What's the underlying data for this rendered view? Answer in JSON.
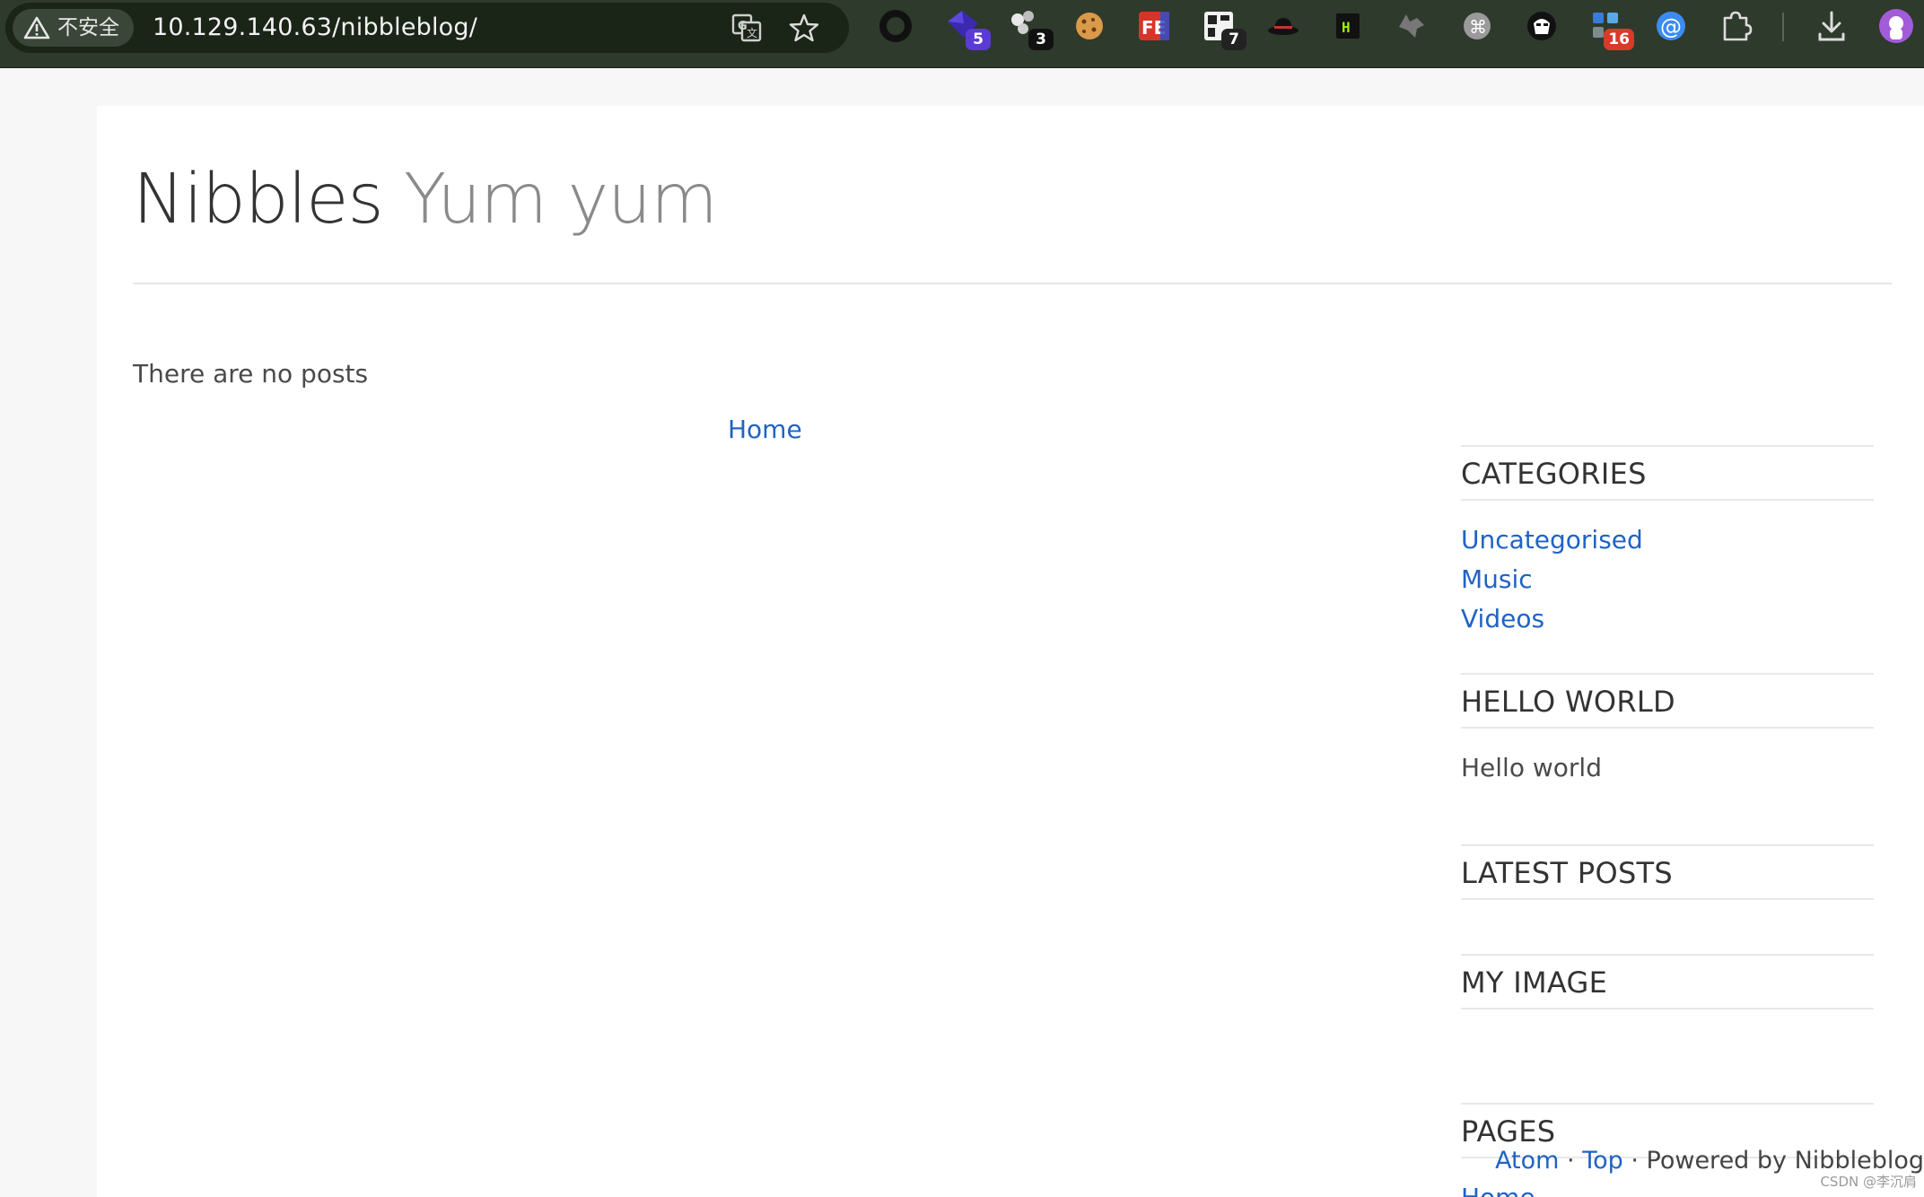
{
  "browser": {
    "security_label": "不安全",
    "url": "10.129.140.63/nibbleblog/",
    "extensions": [
      {
        "icon": "ring-icon",
        "badge": ""
      },
      {
        "icon": "diamond-icon",
        "badge": "5",
        "badge_color": "#5b3bd6"
      },
      {
        "icon": "dots-icon",
        "badge": "3",
        "badge_color": "#111111"
      },
      {
        "icon": "cookie-icon",
        "badge": ""
      },
      {
        "icon": "fe-icon",
        "badge": ""
      },
      {
        "icon": "qr-icon",
        "badge": "7",
        "badge_color": "#222222"
      },
      {
        "icon": "hat-icon",
        "badge": ""
      },
      {
        "icon": "hackthebox-icon",
        "badge": ""
      },
      {
        "icon": "wolf-icon",
        "badge": ""
      },
      {
        "icon": "command-icon",
        "badge": ""
      },
      {
        "icon": "hacker-mask-icon",
        "badge": ""
      },
      {
        "icon": "apps-icon",
        "badge": "16",
        "badge_color": "#d93a2b"
      },
      {
        "icon": "at-sign-icon",
        "badge": ""
      },
      {
        "icon": "puzzle-icon",
        "badge": ""
      },
      {
        "icon": "download-icon",
        "badge": ""
      },
      {
        "icon": "profile-avatar-icon",
        "badge": ""
      }
    ]
  },
  "site": {
    "name": "Nibbles",
    "slogan": "Yum yum"
  },
  "main": {
    "empty_text": "There are no posts",
    "pager_home": "Home"
  },
  "sidebar": {
    "categories": {
      "title": "CATEGORIES",
      "items": [
        "Uncategorised",
        "Music",
        "Videos"
      ]
    },
    "hello_world": {
      "title": "HELLO WORLD",
      "text": "Hello world"
    },
    "latest_posts": {
      "title": "LATEST POSTS"
    },
    "my_image": {
      "title": "MY IMAGE"
    },
    "pages": {
      "title": "PAGES",
      "items": [
        "Home"
      ]
    }
  },
  "footer": {
    "atom": "Atom",
    "sep1": " · ",
    "top": "Top",
    "powered": " · Powered by Nibbleblog"
  },
  "watermark": "CSDN @李沉肩",
  "colors": {
    "link": "#1f63c4",
    "toolbar_bg": "#2e3a2c",
    "text": "#333333",
    "slogan": "#8a8a8a"
  }
}
